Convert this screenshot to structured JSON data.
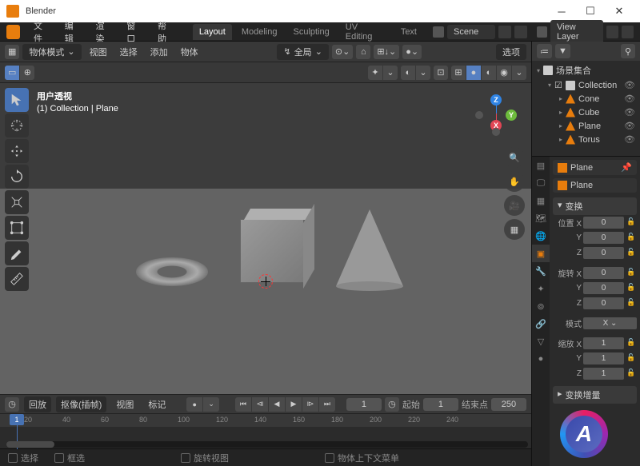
{
  "window": {
    "title": "Blender"
  },
  "menu": {
    "file": "文件",
    "edit": "编辑",
    "render": "渲染",
    "window": "窗口",
    "help": "帮助"
  },
  "workspaces": {
    "layout": "Layout",
    "modeling": "Modeling",
    "sculpting": "Sculpting",
    "uv": "UV Editing",
    "text": "Text"
  },
  "scene": {
    "label": "Scene",
    "layer": "View Layer"
  },
  "header3d": {
    "mode": "物体模式",
    "global": "全局",
    "view": "视图",
    "select": "选择",
    "add": "添加",
    "object": "物体",
    "options": "选项"
  },
  "overlay": {
    "persp": "用户透视",
    "coll": "(1) Collection | Plane"
  },
  "outliner": {
    "title": "场景集合",
    "root": "Collection",
    "items": [
      "Cone",
      "Cube",
      "Plane",
      "Torus"
    ]
  },
  "props": {
    "object": "Plane",
    "section_transform": "变换",
    "pos_label": "位置 X",
    "rot_label": "旋转 X",
    "mode_label": "模式",
    "scale_label": "缩放 X",
    "delta_label": "变换增量",
    "y": "Y",
    "z": "Z",
    "x": "X",
    "pos": [
      "0",
      "0",
      "0"
    ],
    "rot": [
      "0",
      "0",
      "0"
    ],
    "scale": [
      "1",
      "1",
      "1"
    ]
  },
  "timeline": {
    "playback": "回放",
    "keying": "抠像(插帧)",
    "view": "视图",
    "marker": "标记",
    "current": "1",
    "start_label": "起始",
    "start": "1",
    "end_label": "结束点",
    "end": "250",
    "ticks": [
      "20",
      "40",
      "60",
      "80",
      "100",
      "120",
      "140",
      "160",
      "180",
      "200",
      "220",
      "240"
    ]
  },
  "status": {
    "select": "选择",
    "box": "框选",
    "rotate": "旋转视图",
    "context": "物体上下文菜单"
  }
}
